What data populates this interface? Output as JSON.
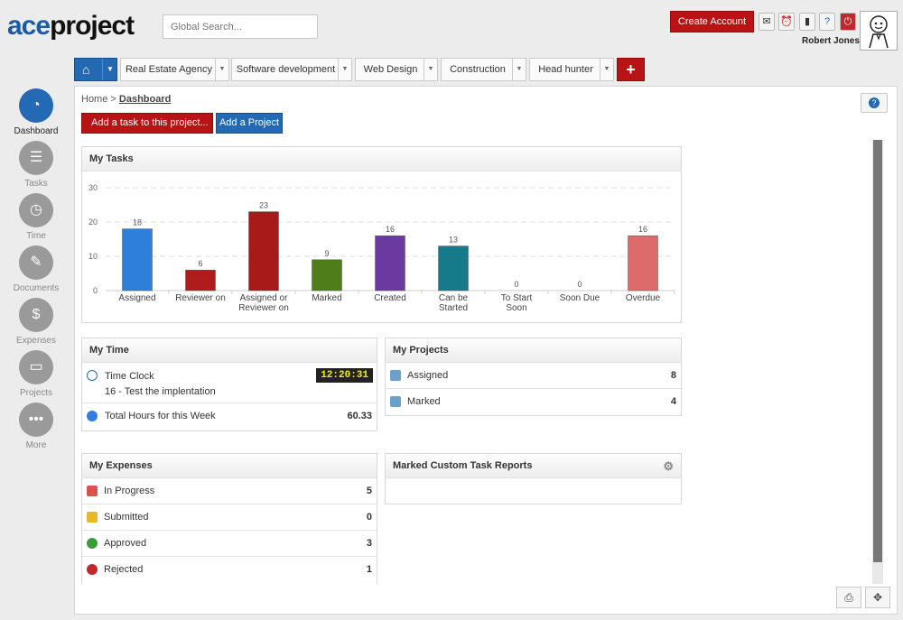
{
  "header": {
    "logo_ace": "ace",
    "logo_project": "project",
    "search_placeholder": "Global Search...",
    "create_account_label": "Create Account",
    "user_name": "Robert Jones",
    "icons": [
      "mail-icon",
      "alarm-clock-icon",
      "mobile-icon",
      "help-icon",
      "power-icon"
    ]
  },
  "tabs": [
    {
      "label": "Real Estate Agency"
    },
    {
      "label": "Software development"
    },
    {
      "label": "Web Design"
    },
    {
      "label": "Construction"
    },
    {
      "label": "Head hunter"
    }
  ],
  "sidebar": [
    {
      "label": "Dashboard",
      "icon": "dashboard-gauge-icon",
      "active": true
    },
    {
      "label": "Tasks",
      "icon": "tasks-document-icon"
    },
    {
      "label": "Time",
      "icon": "clock-icon"
    },
    {
      "label": "Documents",
      "icon": "paperclip-icon"
    },
    {
      "label": "Expenses",
      "icon": "money-bag-icon"
    },
    {
      "label": "Projects",
      "icon": "folder-icon"
    },
    {
      "label": "More",
      "icon": "ellipsis-icon"
    }
  ],
  "breadcrumb": {
    "home": "Home",
    "separator": ">",
    "current": "Dashboard"
  },
  "actions": {
    "add_task": "Add a task to this project...",
    "add_project": "Add a Project"
  },
  "my_tasks": {
    "title": "My Tasks"
  },
  "chart_data": {
    "type": "bar",
    "categories": [
      "Assigned",
      "Reviewer on",
      "Assigned or Reviewer on",
      "Marked",
      "Created",
      "Can be Started",
      "To Start Soon",
      "Soon Due",
      "Overdue"
    ],
    "category_lines": [
      [
        "Assigned"
      ],
      [
        "Reviewer on"
      ],
      [
        "Assigned or",
        "Reviewer on"
      ],
      [
        "Marked"
      ],
      [
        "Created"
      ],
      [
        "Can be",
        "Started"
      ],
      [
        "To Start",
        "Soon"
      ],
      [
        "Soon Due"
      ],
      [
        "Overdue"
      ]
    ],
    "values": [
      18,
      6,
      23,
      9,
      16,
      13,
      0,
      0,
      16
    ],
    "colors": [
      "#2e7fd9",
      "#b01c1c",
      "#a81a1a",
      "#4f7d19",
      "#6b3aa1",
      "#167a8a",
      "#999999",
      "#999999",
      "#de6b6b"
    ],
    "yticks": [
      0,
      10,
      20,
      30
    ],
    "ylim": [
      0,
      30
    ],
    "grid": true
  },
  "my_time": {
    "title": "My Time",
    "clock_label": "Time Clock",
    "clock_value": "12:20:31",
    "clock_task": "16 - Test the implentation",
    "total_label": "Total Hours for this Week",
    "total_value": "60.33"
  },
  "my_projects": {
    "title": "My Projects",
    "rows": [
      {
        "label": "Assigned",
        "value": "8"
      },
      {
        "label": "Marked",
        "value": "4"
      }
    ]
  },
  "my_expenses": {
    "title": "My Expenses",
    "rows": [
      {
        "label": "In Progress",
        "value": "5",
        "color": "#d9534f"
      },
      {
        "label": "Submitted",
        "value": "0",
        "color": "#e8b828"
      },
      {
        "label": "Approved",
        "value": "3",
        "color": "#3a9d3a"
      },
      {
        "label": "Rejected",
        "value": "1",
        "color": "#c0282d"
      }
    ]
  },
  "custom_reports": {
    "title": "Marked Custom Task Reports"
  }
}
